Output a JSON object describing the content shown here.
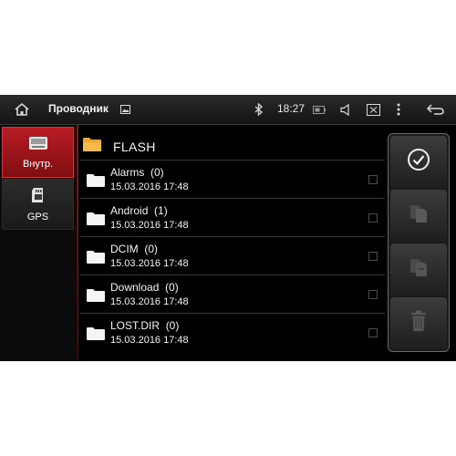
{
  "statusbar": {
    "app_title": "Проводник",
    "time": "18:27",
    "icons": [
      "home-icon",
      "image-icon",
      "bluetooth-icon",
      "battery-icon",
      "volume-icon",
      "screenshot-icon",
      "more-icon",
      "back-icon"
    ]
  },
  "sidebar": {
    "items": [
      {
        "label": "Внутр.",
        "icon": "internal-storage-icon",
        "active": true
      },
      {
        "label": "GPS",
        "icon": "sd-card-icon",
        "active": false
      }
    ]
  },
  "path": {
    "label": "FLASH",
    "icon": "folder-open-icon"
  },
  "files": [
    {
      "name": "Alarms",
      "count": "(0)",
      "date": "15.03.2016 17:48"
    },
    {
      "name": "Android",
      "count": "(1)",
      "date": "15.03.2016 17:48"
    },
    {
      "name": "DCIM",
      "count": "(0)",
      "date": "15.03.2016 17:48"
    },
    {
      "name": "Download",
      "count": "(0)",
      "date": "15.03.2016 17:48"
    },
    {
      "name": "LOST.DIR",
      "count": "(0)",
      "date": "15.03.2016 17:48"
    }
  ],
  "actions": [
    {
      "icon": "check-icon",
      "enabled": true
    },
    {
      "icon": "copy-icon",
      "enabled": false
    },
    {
      "icon": "paste-icon",
      "enabled": false
    },
    {
      "icon": "trash-icon",
      "enabled": false
    }
  ],
  "colors": {
    "accent": "#b81c22",
    "folder": "#f5a623",
    "background": "#000000"
  }
}
